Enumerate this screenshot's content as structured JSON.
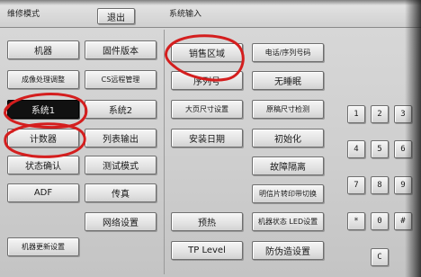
{
  "header": {
    "mode_title": "维修模式",
    "exit_label": "退出",
    "system_input_title": "系统输入"
  },
  "left_menu": {
    "machine": "机器",
    "firmware_version": "固件版本",
    "image_adjust": "成像处理调整",
    "cs_remote": "CS远程管理",
    "system1": "系统1",
    "system2": "系统2",
    "counter": "计数器",
    "list_output": "列表输出",
    "status_check": "状态确认",
    "test_mode": "测试模式",
    "adf": "ADF",
    "fax": "传真",
    "network_settings": "网络设置",
    "machine_update": "机器更新设置"
  },
  "system_panel": {
    "sales_region": "销售区域",
    "phone_serial": "电话/序列号码",
    "serial_no": "序列号",
    "no_sleep": "无睡眠",
    "large_size": "大页尺寸设置",
    "original_size_detect": "原稿尺寸检测",
    "install_date": "安装日期",
    "initialize": "初始化",
    "fault_isolation": "故障隔离",
    "postcard_switch": "明信片转印带切换",
    "preheat": "预热",
    "led_settings": "机器状态 LED设置",
    "tp_level": "TP Level",
    "anti_copy": "防伪造设置"
  },
  "keypad": {
    "k1": "1",
    "k2": "2",
    "k3": "3",
    "k4": "4",
    "k5": "5",
    "k6": "6",
    "k7": "7",
    "k8": "8",
    "k9": "9",
    "kstar": "*",
    "k0": "0",
    "khash": "#",
    "kc": "C"
  },
  "annotation_color": "#d41e1e"
}
